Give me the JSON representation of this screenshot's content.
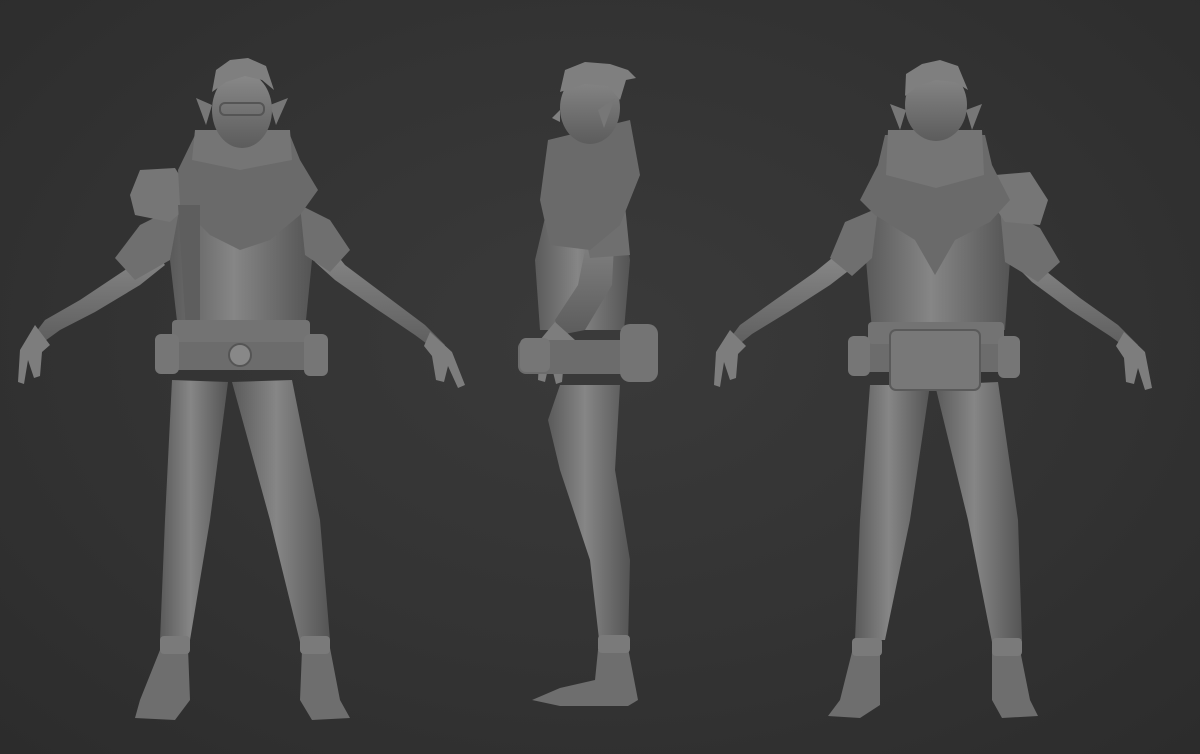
{
  "scene": {
    "background_color": "#333333",
    "clay_color": "#7b7b7b",
    "views": [
      {
        "name": "front"
      },
      {
        "name": "side"
      },
      {
        "name": "back"
      }
    ]
  }
}
